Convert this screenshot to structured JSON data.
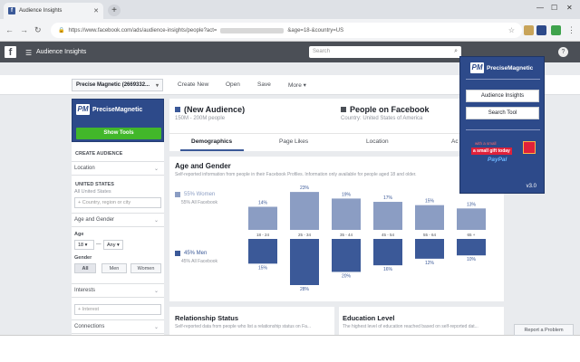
{
  "browser": {
    "tab_title": "Audience Insights",
    "url_prefix": "https://www.facebook.com/ads/audience-insights/people?act=",
    "url_suffix": "&age=18-&country=US"
  },
  "fb": {
    "title": "Audience Insights",
    "search_placeholder": "Search",
    "help": "?"
  },
  "toolbar": {
    "audience_select": "Precise Magnetic (2669332...",
    "create_new": "Create New",
    "open": "Open",
    "save": "Save",
    "more": "More ▾"
  },
  "left": {
    "brand": "PreciseMagnetic",
    "show_tools": "Show Tools",
    "create_audience": "CREATE AUDIENCE",
    "location": "Location",
    "united_states": "UNITED STATES",
    "all_us": "All United States",
    "country_placeholder": "+ Country, region or city",
    "age_gender": "Age and Gender",
    "age": "Age",
    "age_from": "18 ▾",
    "dash": "—",
    "age_to": "Any ▾",
    "gender": "Gender",
    "gender_opts": [
      "All",
      "Men",
      "Women"
    ],
    "interests": "Interests",
    "interest_placeholder": "+ Interest",
    "connections": "Connections"
  },
  "header": {
    "audience_name": "(New Audience)",
    "audience_size": "150M - 200M people",
    "people_title": "People on Facebook",
    "country": "Country: United States of America"
  },
  "tabs": [
    "Demographics",
    "Page Likes",
    "Location",
    "Ac"
  ],
  "age_gender": {
    "title": "Age and Gender",
    "desc": "Self-reported information from people in their Facebook Profiles. Information only available for people aged 18 and older.",
    "women_label": "55% Women",
    "women_sub": "55% All Facebook",
    "men_label": "45% Men",
    "men_sub": "45% All Facebook"
  },
  "chart_data": {
    "type": "bar",
    "categories": [
      "18 - 24",
      "25 - 34",
      "35 - 44",
      "45 - 54",
      "55 - 64",
      "65 +"
    ],
    "series": [
      {
        "name": "55% Women",
        "values": [
          14,
          23,
          19,
          17,
          15,
          13
        ],
        "labels": [
          "14%",
          "23%",
          "19%",
          "17%",
          "15%",
          "13%"
        ],
        "color": "#8b9dc3"
      },
      {
        "name": "45% Men",
        "values": [
          15,
          28,
          20,
          16,
          12,
          10
        ],
        "labels": [
          "15%",
          "28%",
          "20%",
          "16%",
          "12%",
          "10%"
        ],
        "color": "#3b5998"
      }
    ]
  },
  "relationship": {
    "title": "Relationship Status",
    "desc": "Self-reported data from people who list a relationship status on Fa..."
  },
  "education": {
    "title": "Education Level",
    "desc": "The highest level of education reached based on self-reported dat..."
  },
  "popup": {
    "brand": "PreciseMagnetic",
    "audience_insights": "Audience Insights",
    "search_tool": "Search Tool",
    "gift_line1": "with a small",
    "gift_line2": "a small gift today",
    "gift_paypal": "PayPal",
    "version": "v3.0"
  },
  "report": "Report a Problem",
  "colors": {
    "fb_blue": "#3b5998",
    "women": "#8b9dc3",
    "men": "#3b5998",
    "green": "#42b72a"
  }
}
